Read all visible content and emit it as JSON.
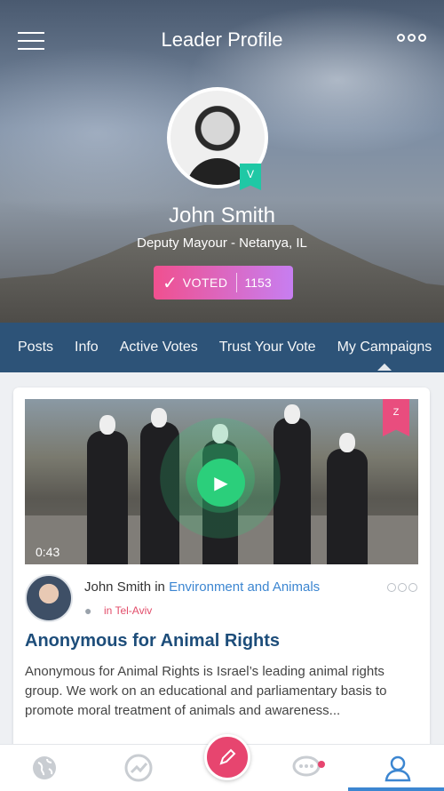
{
  "header": {
    "title": "Leader Profile",
    "menu_icon": "hamburger-icon",
    "more_icon": "more-dots-icon"
  },
  "profile": {
    "name": "John Smith",
    "role": "Deputy Mayour - Netanya, IL",
    "badge": "V",
    "vote": {
      "check": "✓",
      "label": "VOTED",
      "count": "1153"
    }
  },
  "tabs": [
    "Posts",
    "Info",
    "Active Votes",
    "Trust Your Vote",
    "My Campaigns"
  ],
  "post": {
    "duration": "0:43",
    "corner_badge": "Z",
    "author": "John Smith",
    "in_word": "in",
    "category": "Environment and Animals",
    "location": "in Tel-Aviv",
    "title": "Anonymous for Animal Rights",
    "body": "Anonymous for Animal Rights is Israel’s leading animal rights group. We work on an educational and parliamentary basis to promote moral treatment of animals and awareness..."
  },
  "nav": {
    "items": [
      "globe-icon",
      "trending-icon",
      "compose-icon",
      "chat-icon",
      "profile-icon"
    ]
  },
  "colors": {
    "tab_bar": "#2d5378",
    "accent_blue": "#3c86d1",
    "accent_pink": "#e7456f",
    "play_green": "#2bcf7b",
    "verified_teal": "#1fc8a5"
  }
}
